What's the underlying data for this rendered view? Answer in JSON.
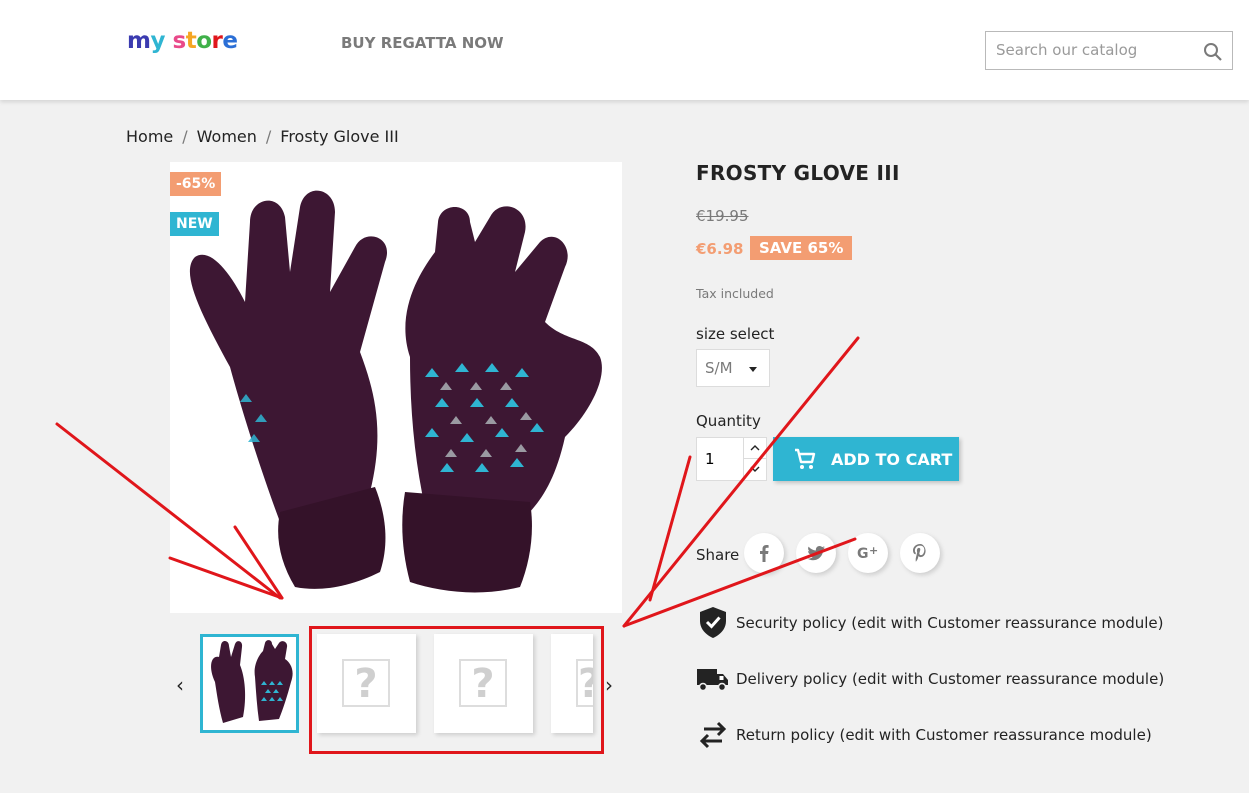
{
  "header": {
    "logo_parts": [
      "m",
      "y",
      " ",
      "s",
      "t",
      "o",
      "r",
      "e"
    ],
    "logo_colors": [
      "#3b3bb0",
      "#2fb5d2",
      "",
      "#e94a8a",
      "#f5a623",
      "#3fb049",
      "#e0161b",
      "#2b6fd6"
    ],
    "nav_link": "BUY REGATTA NOW",
    "search_placeholder": "Search our catalog"
  },
  "breadcrumb": [
    "Home",
    "Women",
    "Frosty Glove III"
  ],
  "product": {
    "flags": {
      "discount": "-65%",
      "new": "NEW"
    },
    "title": "FROSTY GLOVE III",
    "regular_price": "€19.95",
    "price": "€6.98",
    "save_label": "SAVE 65%",
    "tax_label": "Tax included",
    "size_label": "size select",
    "size_value": "S/M",
    "quantity_label": "Quantity",
    "quantity_value": "1",
    "add_to_cart_label": "ADD TO CART",
    "share_label": "Share",
    "social_icons": [
      "facebook-icon",
      "twitter-icon",
      "google-plus-icon",
      "pinterest-icon"
    ]
  },
  "thumbnails": {
    "count_visible": 4,
    "selected_index": 0,
    "placeholder_glyph": "?"
  },
  "reassurance": [
    {
      "icon": "shield-check-icon",
      "text": "Security policy (edit with Customer reassurance module)"
    },
    {
      "icon": "truck-icon",
      "text": "Delivery policy (edit with Customer reassurance module)"
    },
    {
      "icon": "exchange-arrows-icon",
      "text": "Return policy (edit with Customer reassurance module)"
    }
  ],
  "colors": {
    "accent": "#2fb5d2",
    "discount": "#f39d72",
    "annotation": "#e0161b"
  }
}
